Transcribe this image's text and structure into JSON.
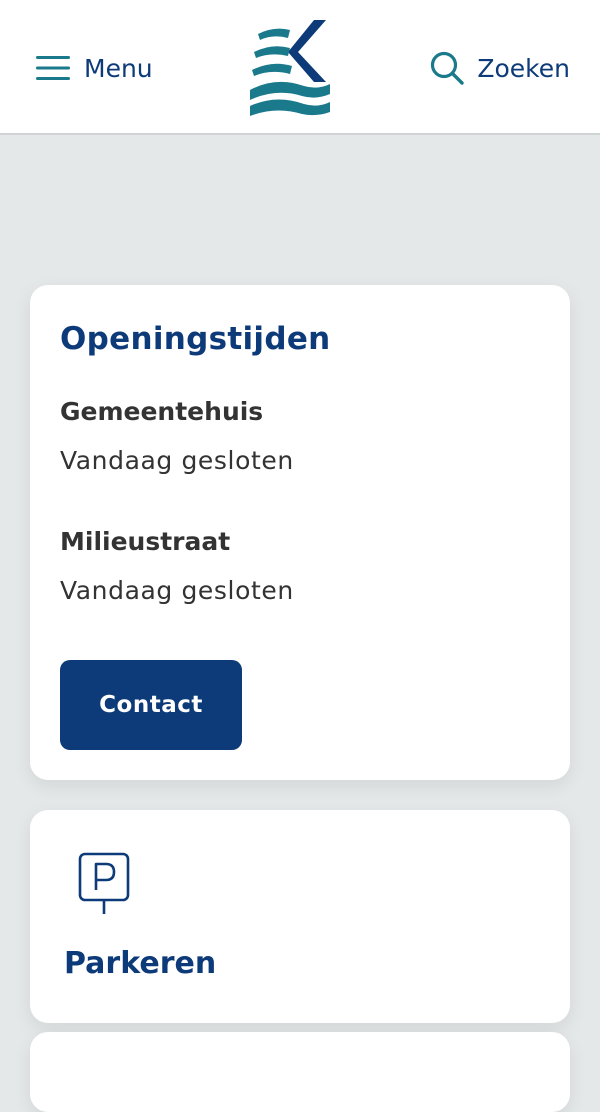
{
  "header": {
    "menu_label": "Menu",
    "search_label": "Zoeken",
    "icons": {
      "menu": "hamburger-icon",
      "logo": "municipality-logo",
      "search": "search-icon"
    }
  },
  "opening_hours": {
    "title": "Openingstijden",
    "locations": [
      {
        "name": "Gemeentehuis",
        "status": "Vandaag gesloten"
      },
      {
        "name": "Milieustraat",
        "status": "Vandaag gesloten"
      }
    ],
    "contact_label": "Contact"
  },
  "parking": {
    "title": "Parkeren",
    "icon": "parking-sign-icon"
  },
  "colors": {
    "brand_navy": "#0d3a78",
    "brand_teal": "#1a7a8c",
    "page_bg": "#e4e8e9",
    "text_dark": "#333333"
  }
}
